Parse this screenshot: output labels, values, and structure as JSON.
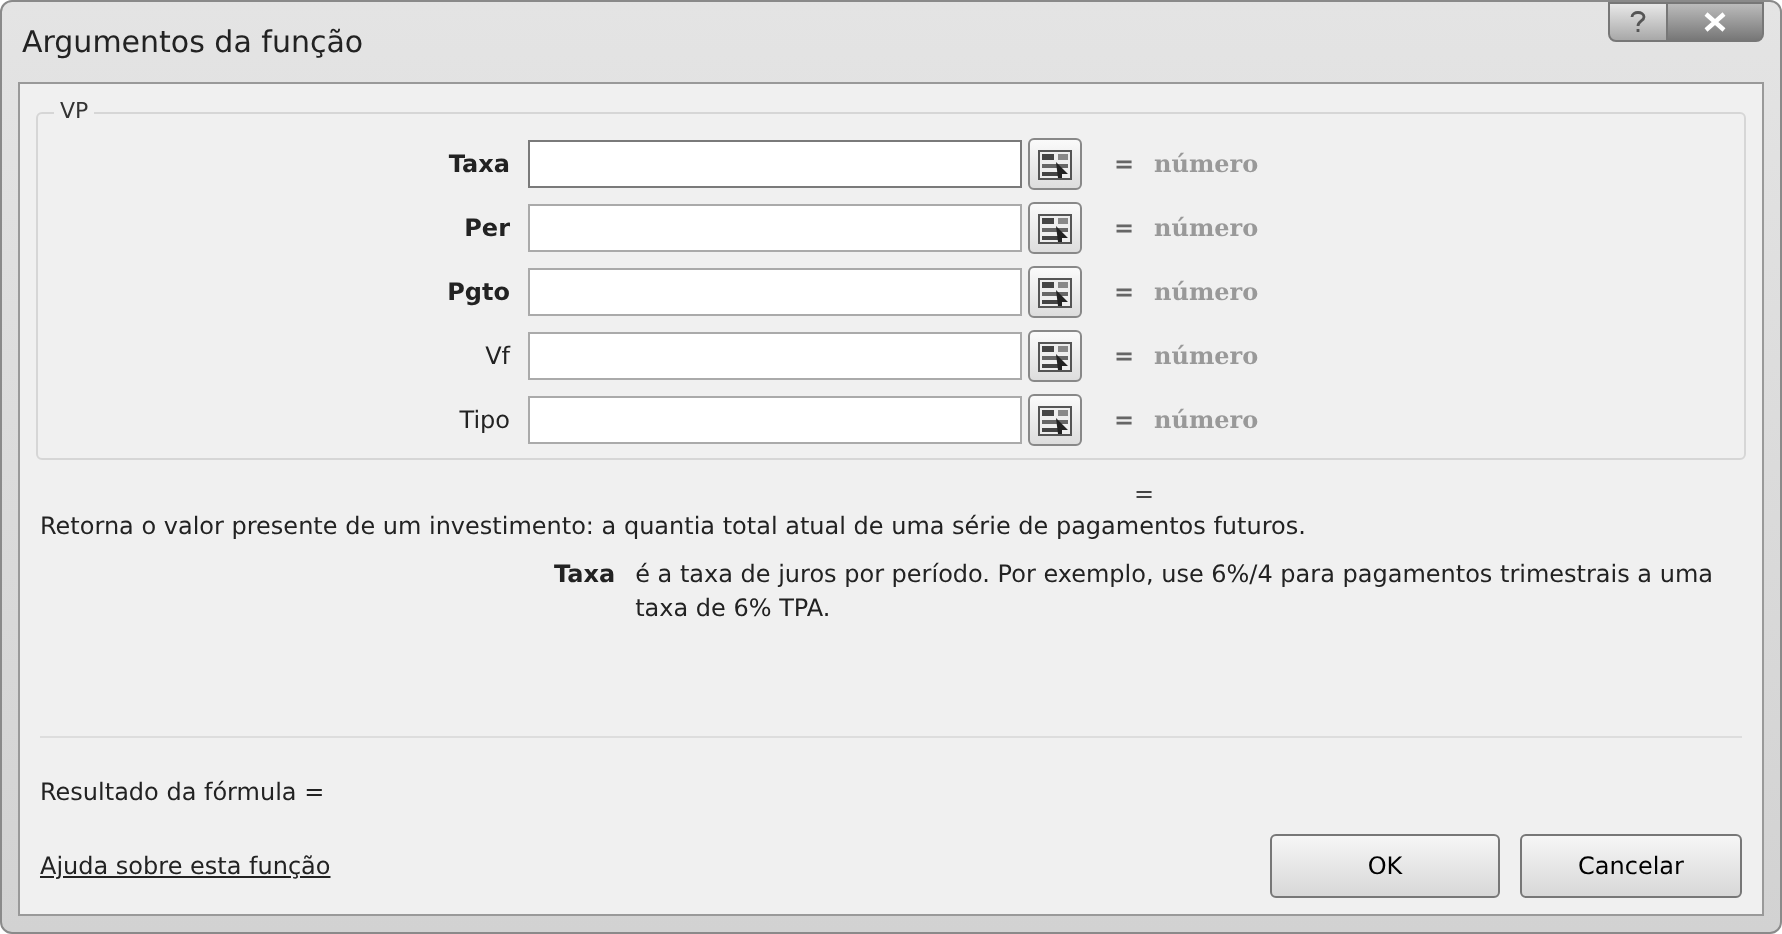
{
  "window": {
    "title": "Argumentos da função"
  },
  "group": {
    "title": "VP"
  },
  "arguments": [
    {
      "label": "Taxa",
      "required": true,
      "focused": true,
      "equals": "=",
      "result": "número"
    },
    {
      "label": "Per",
      "required": true,
      "focused": false,
      "equals": "=",
      "result": "número"
    },
    {
      "label": "Pgto",
      "required": true,
      "focused": false,
      "equals": "=",
      "result": "número"
    },
    {
      "label": "Vf",
      "required": false,
      "focused": false,
      "equals": "=",
      "result": "número"
    },
    {
      "label": "Tipo",
      "required": false,
      "focused": false,
      "equals": "=",
      "result": "número"
    }
  ],
  "function_result": "=",
  "description": "Retorna o valor presente de um investimento: a quantia total atual de uma série de pagamentos futuros.",
  "argument_help": {
    "name": "Taxa",
    "text": "é a taxa de juros por período. Por exemplo, use 6%/4 para pagamentos trimestrais a uma taxa de 6% TPA."
  },
  "formula_result": "Resultado da fórmula =",
  "help_link": "Ajuda sobre esta função",
  "buttons": [
    "OK",
    "Cancelar"
  ]
}
